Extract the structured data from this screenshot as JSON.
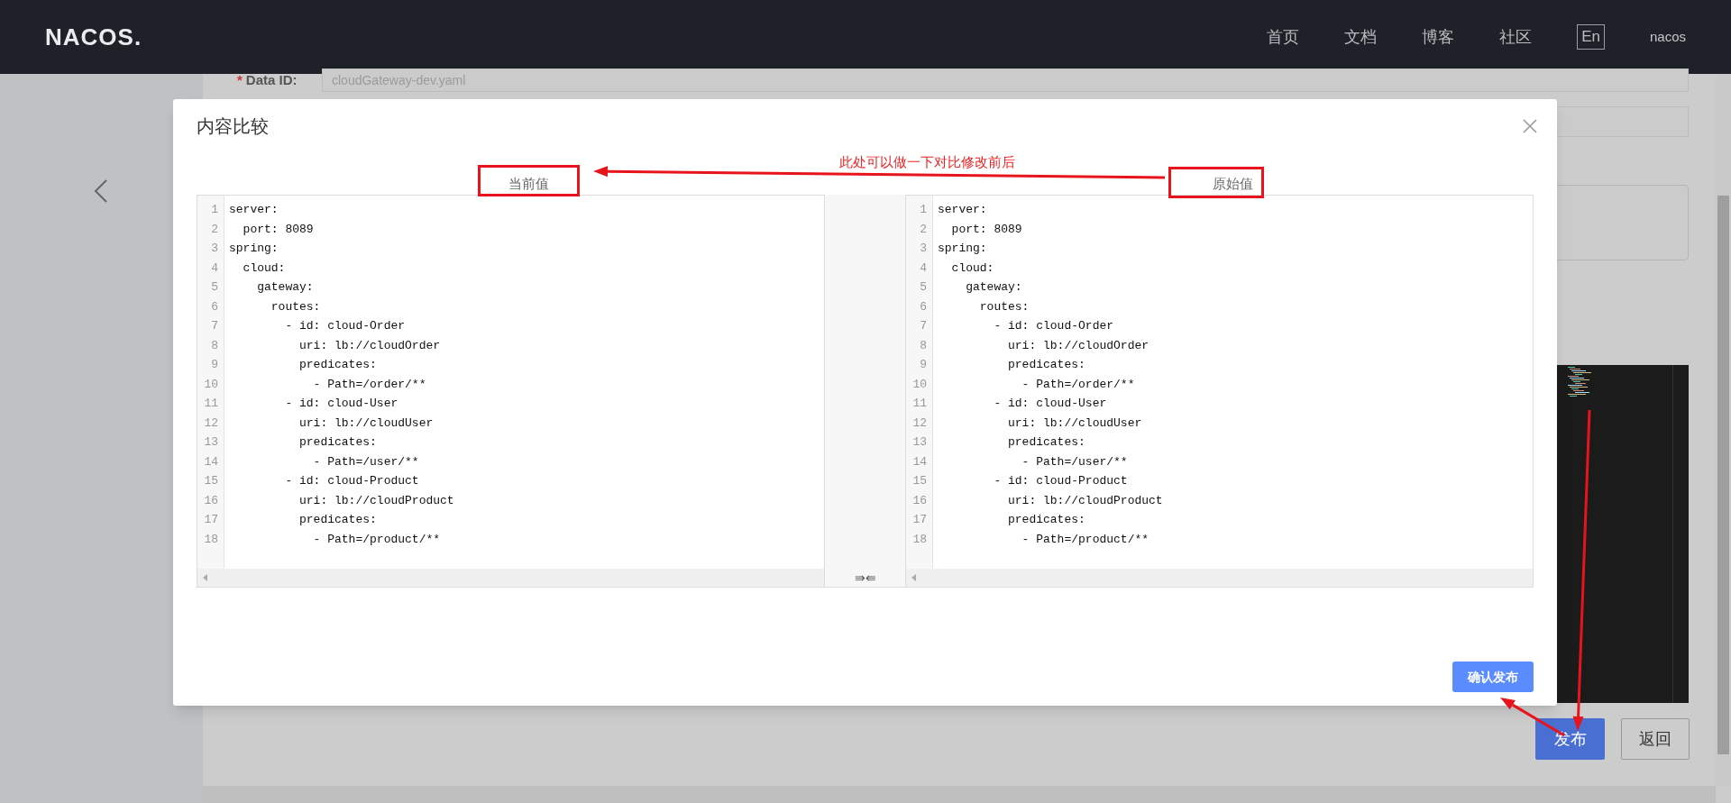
{
  "header": {
    "logo": "NACOS.",
    "nav": [
      {
        "label": "首页"
      },
      {
        "label": "文档"
      },
      {
        "label": "博客"
      },
      {
        "label": "社区"
      }
    ],
    "language": "En",
    "user": "nacos"
  },
  "background_form": {
    "required_mark": "*",
    "label": "Data ID:",
    "value": "cloudGateway-dev.yaml",
    "primary_button": "发布",
    "secondary_button": "返回"
  },
  "dialog": {
    "title": "内容比较",
    "annotation": "此处可以做一下对比修改前后",
    "current_label": "当前值",
    "original_label": "原始值",
    "merge_glyph": "⇛⇚",
    "confirm_button": "确认发布",
    "current_lines": [
      {
        "number": "1",
        "text": "server:"
      },
      {
        "number": "2",
        "text": "  port: 8089"
      },
      {
        "number": "3",
        "text": "spring:"
      },
      {
        "number": "4",
        "text": "  cloud:"
      },
      {
        "number": "5",
        "text": "    gateway:"
      },
      {
        "number": "6",
        "text": "      routes:"
      },
      {
        "number": "7",
        "text": "        - id: cloud-Order"
      },
      {
        "number": "8",
        "text": "          uri: lb://cloudOrder"
      },
      {
        "number": "9",
        "text": "          predicates:"
      },
      {
        "number": "10",
        "text": "            - Path=/order/**"
      },
      {
        "number": "11",
        "text": "        - id: cloud-User"
      },
      {
        "number": "12",
        "text": "          uri: lb://cloudUser"
      },
      {
        "number": "13",
        "text": "          predicates:"
      },
      {
        "number": "14",
        "text": "            - Path=/user/**"
      },
      {
        "number": "15",
        "text": "        - id: cloud-Product"
      },
      {
        "number": "16",
        "text": "          uri: lb://cloudProduct"
      },
      {
        "number": "17",
        "text": "          predicates:"
      },
      {
        "number": "18",
        "text": "            - Path=/product/**"
      }
    ],
    "original_lines": [
      {
        "number": "1",
        "text": "server:"
      },
      {
        "number": "2",
        "text": "  port: 8089"
      },
      {
        "number": "3",
        "text": "spring:"
      },
      {
        "number": "4",
        "text": "  cloud:"
      },
      {
        "number": "5",
        "text": "    gateway:"
      },
      {
        "number": "6",
        "text": "      routes:"
      },
      {
        "number": "7",
        "text": "        - id: cloud-Order"
      },
      {
        "number": "8",
        "text": "          uri: lb://cloudOrder"
      },
      {
        "number": "9",
        "text": "          predicates:"
      },
      {
        "number": "10",
        "text": "            - Path=/order/**"
      },
      {
        "number": "11",
        "text": "        - id: cloud-User"
      },
      {
        "number": "12",
        "text": "          uri: lb://cloudUser"
      },
      {
        "number": "13",
        "text": "          predicates:"
      },
      {
        "number": "14",
        "text": "            - Path=/user/**"
      },
      {
        "number": "15",
        "text": "        - id: cloud-Product"
      },
      {
        "number": "16",
        "text": "          uri: lb://cloudProduct"
      },
      {
        "number": "17",
        "text": "          predicates:"
      },
      {
        "number": "18",
        "text": "            - Path=/product/**"
      }
    ]
  }
}
